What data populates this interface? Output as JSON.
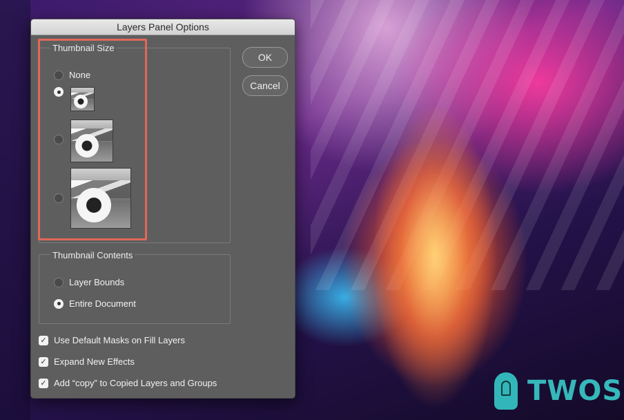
{
  "dialog": {
    "title": "Layers Panel Options",
    "ok_label": "OK",
    "cancel_label": "Cancel"
  },
  "thumbnail_size": {
    "group_title": "Thumbnail Size",
    "options": [
      {
        "label": "None",
        "selected": false
      },
      {
        "label": "",
        "selected": true,
        "size": "small"
      },
      {
        "label": "",
        "selected": false,
        "size": "medium"
      },
      {
        "label": "",
        "selected": false,
        "size": "large"
      }
    ]
  },
  "thumbnail_contents": {
    "group_title": "Thumbnail Contents",
    "options": [
      {
        "label": "Layer Bounds",
        "selected": false
      },
      {
        "label": "Entire Document",
        "selected": true
      }
    ]
  },
  "checkboxes": [
    {
      "label": "Use Default Masks on Fill Layers",
      "checked": true
    },
    {
      "label": "Expand New Effects",
      "checked": true
    },
    {
      "label": "Add “copy” to Copied Layers and Groups",
      "checked": true
    }
  ],
  "watermark": {
    "text": "TWOS"
  },
  "colors": {
    "highlight": "#e2675a",
    "dialog_bg": "#5e5e5e",
    "watermark": "#36b8bb"
  }
}
